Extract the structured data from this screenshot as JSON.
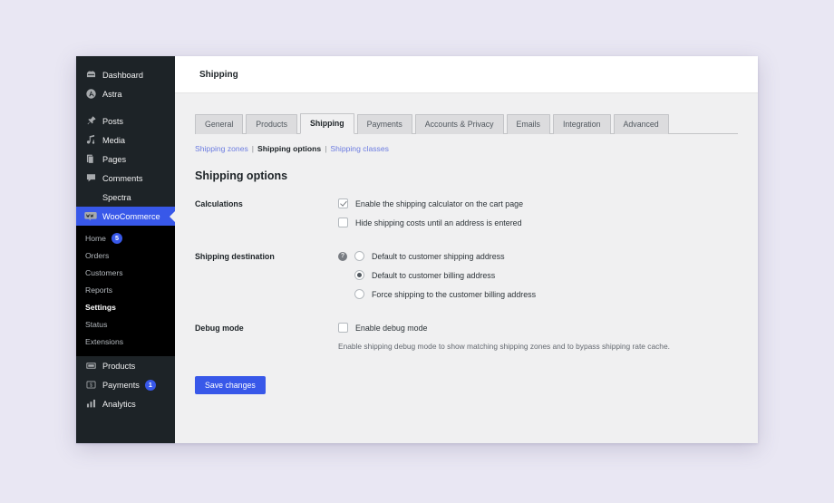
{
  "window": {
    "topbar_title": "Shipping"
  },
  "sidebar": {
    "items": [
      {
        "label": "Dashboard",
        "icon": "dashboard-icon",
        "current": false
      },
      {
        "label": "Astra",
        "icon": "astra-icon",
        "current": false
      },
      {
        "label": "Posts",
        "icon": "pin-icon",
        "current": false
      },
      {
        "label": "Media",
        "icon": "media-icon",
        "current": false
      },
      {
        "label": "Pages",
        "icon": "pages-icon",
        "current": false
      },
      {
        "label": "Comments",
        "icon": "comments-icon",
        "current": false
      },
      {
        "label": "Spectra",
        "icon": "",
        "current": false
      },
      {
        "label": "WooCommerce",
        "icon": "woocommerce-icon",
        "current": true
      }
    ],
    "submenu": [
      {
        "label": "Home",
        "badge": "5",
        "active": false
      },
      {
        "label": "Orders",
        "badge": "",
        "active": false
      },
      {
        "label": "Customers",
        "badge": "",
        "active": false
      },
      {
        "label": "Reports",
        "badge": "",
        "active": false
      },
      {
        "label": "Settings",
        "badge": "",
        "active": true
      },
      {
        "label": "Status",
        "badge": "",
        "active": false
      },
      {
        "label": "Extensions",
        "badge": "",
        "active": false
      }
    ],
    "items_after": [
      {
        "label": "Products",
        "icon": "products-icon",
        "badge": ""
      },
      {
        "label": "Payments",
        "icon": "payments-icon",
        "badge": "1"
      },
      {
        "label": "Analytics",
        "icon": "analytics-icon",
        "badge": ""
      }
    ],
    "accent_color": "#3858e9"
  },
  "tabs": [
    {
      "label": "General",
      "active": false
    },
    {
      "label": "Products",
      "active": false
    },
    {
      "label": "Shipping",
      "active": true
    },
    {
      "label": "Payments",
      "active": false
    },
    {
      "label": "Accounts & Privacy",
      "active": false
    },
    {
      "label": "Emails",
      "active": false
    },
    {
      "label": "Integration",
      "active": false
    },
    {
      "label": "Advanced",
      "active": false
    }
  ],
  "subnav": {
    "zones": "Shipping zones",
    "sep1": "|",
    "options": "Shipping options",
    "sep2": "|",
    "classes": "Shipping classes",
    "link_color": "#6c7ce0"
  },
  "section": {
    "title": "Shipping options"
  },
  "form": {
    "calculations": {
      "label": "Calculations",
      "option_calculator": "Enable the shipping calculator on the cart page",
      "option_calculator_checked": true,
      "option_hide": "Hide shipping costs until an address is entered",
      "option_hide_checked": false
    },
    "destination": {
      "label": "Shipping destination",
      "help_glyph": "?",
      "option_shipping": "Default to customer shipping address",
      "option_billing": "Default to customer billing address",
      "option_force": "Force shipping to the customer billing address",
      "selected": "billing"
    },
    "debug": {
      "label": "Debug mode",
      "option_enable": "Enable debug mode",
      "option_enable_checked": false,
      "description": "Enable shipping debug mode to show matching shipping zones and to bypass shipping rate cache."
    }
  },
  "actions": {
    "save_label": "Save changes",
    "save_color": "#3858e9"
  }
}
